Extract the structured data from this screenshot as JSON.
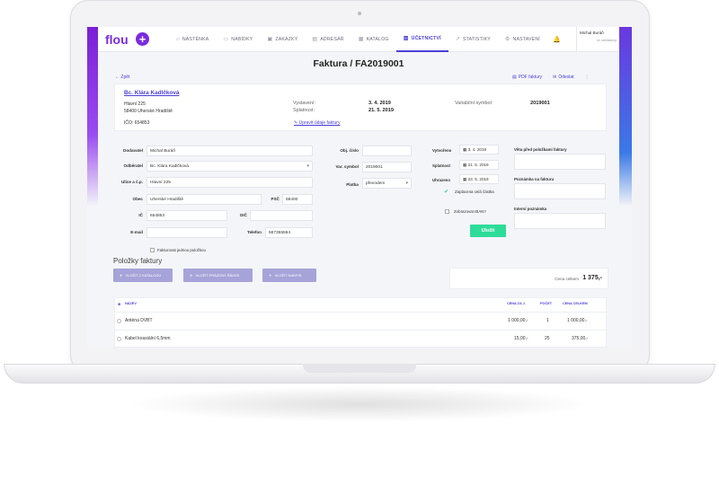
{
  "app": {
    "logo": "flou",
    "plus": "+",
    "nav": [
      {
        "icon": "⌂",
        "label": "NÁSTĚNKA"
      },
      {
        "icon": "▭",
        "label": "NABÍDKY"
      },
      {
        "icon": "▣",
        "label": "ZAKÁZKY"
      },
      {
        "icon": "▤",
        "label": "ADRESÁŘ"
      },
      {
        "icon": "▦",
        "label": "KATALOG"
      },
      {
        "icon": "▥",
        "label": "ÚČETNICTVÍ",
        "active": true
      },
      {
        "icon": "↗",
        "label": "STATISTIKY"
      },
      {
        "icon": "⚙",
        "label": "NASTAVENÍ"
      }
    ],
    "bell": "🔔",
    "user": {
      "name": "Michal Buráň",
      "status": "Je odhlášený"
    }
  },
  "page": {
    "title": "Faktura / FA2019001",
    "back": "← Zpět",
    "actions": {
      "pdf": "PDF faktury",
      "send": "Odeslat",
      "more": "⋮"
    }
  },
  "client": {
    "name": "Bc. Klára Kadlčková",
    "street": "Hlavní 225",
    "city": "58400 Uherské Hradiště",
    "ico": "IČO: 654853",
    "issued_label": "Vystavení:",
    "issued": "3. 4. 2019",
    "due_label": "Splatnost:",
    "due": "21. 5. 2019",
    "vs_label": "Variabilní symbol:",
    "vs": "2019001",
    "edit": "Upravit údaje faktury"
  },
  "form": {
    "supplier_label": "Dodavatel",
    "supplier": "Michal Buráň",
    "customer_label": "Odběratel",
    "customer": "Bc. Klára Kadlčková",
    "street_label": "Ulice a č.p.",
    "street": "Hlavní 225",
    "city_label": "Obec",
    "city": "Uherské Hradiště",
    "zip_label": "PSČ",
    "zip": "58400",
    "ic_label": "IČ",
    "ic": "654853",
    "dic_label": "DIČ",
    "dic": "",
    "email_label": "E-mail",
    "email": "",
    "phone_label": "Telefon",
    "phone": "567355594",
    "single_item": "Fakturovat jednou položkou",
    "order_no_label": "Obj. číslo",
    "order_no": "",
    "var_symbol_label": "Var. symbol",
    "var_symbol": "2019001",
    "payment_label": "Platba",
    "payment": "převodem",
    "created_label": "Vytvořeno",
    "created": "3. 4. 2019",
    "due_label": "Splatnost",
    "due": "21. 5. 2019",
    "paid_label": "Uhrazeno",
    "paid": "23. 5. 2019",
    "paid_full": "Zaplacena celá částka",
    "show_iban": "Zobrazovat IBAN?",
    "save": "Uložit",
    "note_before": "Věta před položkami faktury",
    "note_invoice": "Poznámka na fakturu",
    "note_internal": "Interní poznámka"
  },
  "items": {
    "section": "Položky faktury",
    "btn_catalog": "VLOŽIT Z KATALOGU",
    "btn_empty": "VLOŽIT PRÁZDNÝ ŘÁDEK",
    "btn_heading": "VLOŽIT NADPIS",
    "total_label": "Cena celkem",
    "total": "1 375,-",
    "headers": {
      "name": "NÁZEV",
      "unit": "CENA ZA J.",
      "qty": "POČET",
      "total": "CENA CELKEM"
    },
    "rows": [
      {
        "name": "Anténa DVBT",
        "unit": "1 000,00,-",
        "qty": "1",
        "total": "1 000,00,-"
      },
      {
        "name": "Kabel koaxiální 6,5mm",
        "unit": "15,00,-",
        "qty": "25",
        "total": "375,00,-"
      }
    ]
  }
}
